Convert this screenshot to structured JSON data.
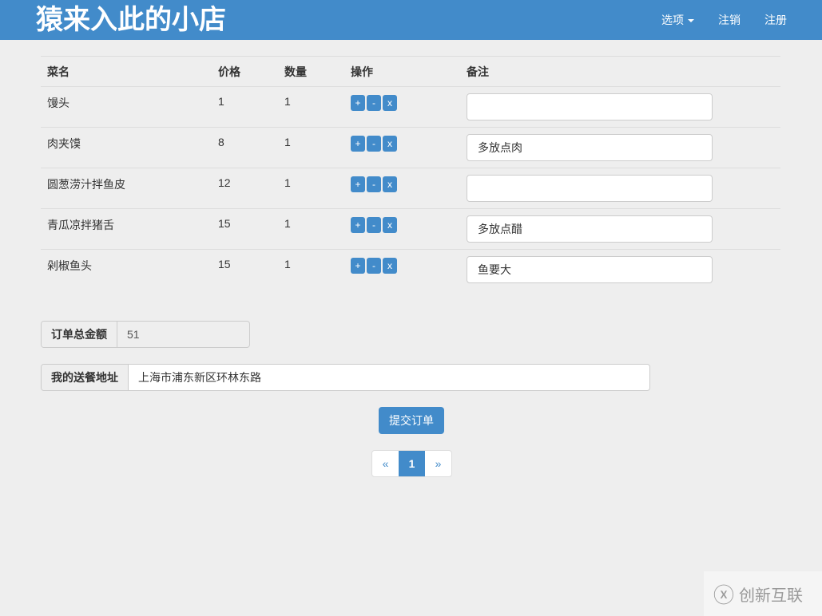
{
  "header": {
    "brand": "猿来入此的小店",
    "menu_options": "选项",
    "logout": "注销",
    "register": "注册"
  },
  "table": {
    "headers": [
      "菜名",
      "价格",
      "数量",
      "操作",
      "备注"
    ],
    "rows": [
      {
        "name": "馒头",
        "price": "1",
        "qty": "1",
        "note": ""
      },
      {
        "name": "肉夹馍",
        "price": "8",
        "qty": "1",
        "note": "多放点肉"
      },
      {
        "name": "圆葱涝汁拌鱼皮",
        "price": "12",
        "qty": "1",
        "note": ""
      },
      {
        "name": "青瓜凉拌猪舌",
        "price": "15",
        "qty": "1",
        "note": "多放点醋"
      },
      {
        "name": "剁椒鱼头",
        "price": "15",
        "qty": "1",
        "note": "鱼要大"
      }
    ],
    "actions": {
      "plus": "+",
      "minus": "-",
      "remove": "x"
    }
  },
  "total": {
    "label": "订单总金额",
    "value": "51"
  },
  "address": {
    "label": "我的送餐地址",
    "value": "上海市浦东新区环林东路"
  },
  "submit_label": "提交订单",
  "pagination": {
    "prev": "«",
    "current": "1",
    "next": "»"
  },
  "watermark": "创新互联"
}
